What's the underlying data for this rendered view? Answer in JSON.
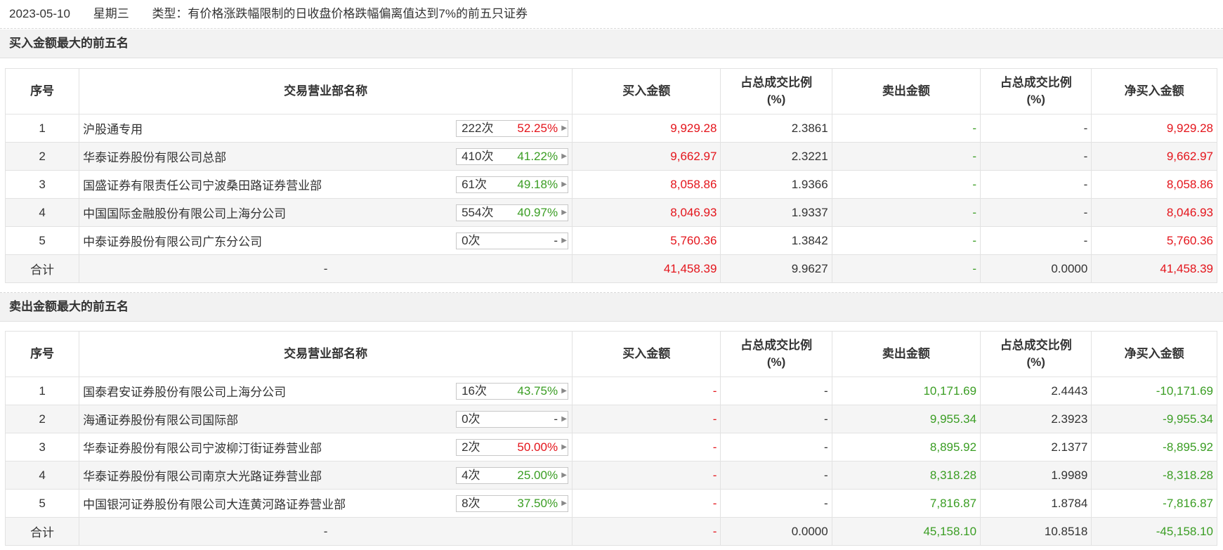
{
  "header": {
    "date": "2023-05-10",
    "weekday": "星期三",
    "type_text": "类型：有价格涨跌幅限制的日收盘价格跌幅偏离值达到7%的前五只证券"
  },
  "columns": {
    "idx": "序号",
    "name": "交易营业部名称",
    "buy": "买入金额",
    "buy_ratio_l1": "占总成交比例",
    "buy_ratio_l2": "(%)",
    "sell": "卖出金额",
    "sell_ratio_l1": "占总成交比例",
    "sell_ratio_l2": "(%)",
    "net": "净买入金额"
  },
  "colors": {
    "red": "#e4141b",
    "green": "#3a9d23",
    "header_bg": "#f2f2f2",
    "row_alt_bg": "#f5f5f5"
  },
  "buy_section": {
    "title": "买入金额最大的前五名",
    "rows": [
      {
        "idx": "1",
        "name": "沪股通专用",
        "count": "222次",
        "pct": "52.25%",
        "pct_color": "red",
        "buy": "9,929.28",
        "buy_ratio": "2.3861",
        "sell": "-",
        "sell_ratio": "-",
        "net": "9,929.28"
      },
      {
        "idx": "2",
        "name": "华泰证券股份有限公司总部",
        "count": "410次",
        "pct": "41.22%",
        "pct_color": "green",
        "buy": "9,662.97",
        "buy_ratio": "2.3221",
        "sell": "-",
        "sell_ratio": "-",
        "net": "9,662.97"
      },
      {
        "idx": "3",
        "name": "国盛证券有限责任公司宁波桑田路证券营业部",
        "count": "61次",
        "pct": "49.18%",
        "pct_color": "green",
        "buy": "8,058.86",
        "buy_ratio": "1.9366",
        "sell": "-",
        "sell_ratio": "-",
        "net": "8,058.86"
      },
      {
        "idx": "4",
        "name": "中国国际金融股份有限公司上海分公司",
        "count": "554次",
        "pct": "40.97%",
        "pct_color": "green",
        "buy": "8,046.93",
        "buy_ratio": "1.9337",
        "sell": "-",
        "sell_ratio": "-",
        "net": "8,046.93"
      },
      {
        "idx": "5",
        "name": "中泰证券股份有限公司广东分公司",
        "count": "0次",
        "pct": "-",
        "pct_color": "dark",
        "buy": "5,760.36",
        "buy_ratio": "1.3842",
        "sell": "-",
        "sell_ratio": "-",
        "net": "5,760.36"
      }
    ],
    "total": {
      "label": "合计",
      "name": "-",
      "buy": "41,458.39",
      "buy_ratio": "9.9627",
      "sell": "-",
      "sell_ratio": "0.0000",
      "net": "41,458.39"
    }
  },
  "sell_section": {
    "title": "卖出金额最大的前五名",
    "rows": [
      {
        "idx": "1",
        "name": "国泰君安证券股份有限公司上海分公司",
        "count": "16次",
        "pct": "43.75%",
        "pct_color": "green",
        "buy": "-",
        "buy_ratio": "-",
        "sell": "10,171.69",
        "sell_ratio": "2.4443",
        "net": "-10,171.69"
      },
      {
        "idx": "2",
        "name": "海通证券股份有限公司国际部",
        "count": "0次",
        "pct": "-",
        "pct_color": "dark",
        "buy": "-",
        "buy_ratio": "-",
        "sell": "9,955.34",
        "sell_ratio": "2.3923",
        "net": "-9,955.34"
      },
      {
        "idx": "3",
        "name": "华泰证券股份有限公司宁波柳汀街证券营业部",
        "count": "2次",
        "pct": "50.00%",
        "pct_color": "red",
        "buy": "-",
        "buy_ratio": "-",
        "sell": "8,895.92",
        "sell_ratio": "2.1377",
        "net": "-8,895.92"
      },
      {
        "idx": "4",
        "name": "华泰证券股份有限公司南京大光路证券营业部",
        "count": "4次",
        "pct": "25.00%",
        "pct_color": "green",
        "buy": "-",
        "buy_ratio": "-",
        "sell": "8,318.28",
        "sell_ratio": "1.9989",
        "net": "-8,318.28"
      },
      {
        "idx": "5",
        "name": "中国银河证券股份有限公司大连黄河路证券营业部",
        "count": "8次",
        "pct": "37.50%",
        "pct_color": "green",
        "buy": "-",
        "buy_ratio": "-",
        "sell": "7,816.87",
        "sell_ratio": "1.8784",
        "net": "-7,816.87"
      }
    ],
    "total": {
      "label": "合计",
      "name": "-",
      "buy": "-",
      "buy_ratio": "0.0000",
      "sell": "45,158.10",
      "sell_ratio": "10.8518",
      "net": "-45,158.10"
    }
  }
}
